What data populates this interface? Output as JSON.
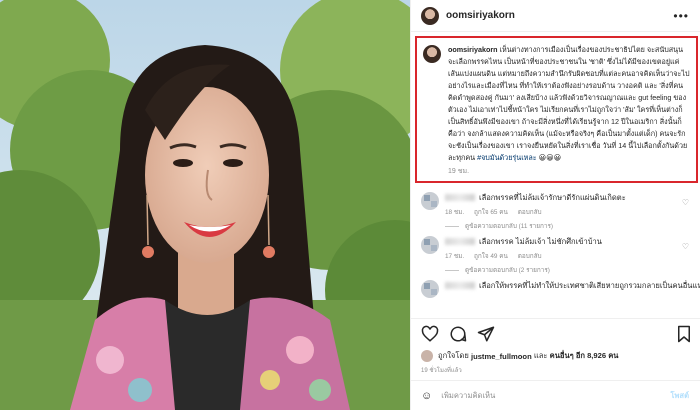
{
  "post": {
    "username": "oomsiriyakorn",
    "more_icon": "more-horizontal-icon"
  },
  "caption": {
    "username": "oomsiriyakorn",
    "text": "เห็นต่างทางการเมืองเป็นเรื่องของประชาธิปไตย จะสนับสนุนจะเลือกพรรคไหน เป็นหน้าที่ของประชาชนใน 'ชาติ' ซึ่งไม่ได้มีของเขตอยู่แค่เส้นแบ่งแผนดิน แต่หมายถึงความสำนึกรับผิดชอบที่แต่ละคนอาจคิดเห็นว่าจะไปอย่างไรและเมืองที่ไหน ที่ทำให้เราต้องฟังอย่างรอบด้าน วางอคติ และ 'สิ่งที่คนคิดดำพูดสองคู่ กันมา' ลงเสียบ้าง แล้วฟังด้วยวิจารณญาณและ gut feeling ของตัวเอง ไม่เอาเท่าไปชี้หน้าใคร ไม่เรียกคนที่เราไม่ถูกใจว่า 'ส้ม' ใครที่เห็นต่างก็เป็นสิทธิ์อันพึงมีของเขา ถ้าจะมีสิ่งหนึ่งที่ได้เรียนรู้จาก 12 ปีในอเมริกา สิ่งนั้นก็คือว่า จงกล้าแสดงความคิดเห็น (แม้จะหรือจริงๆ คือเป็นมาตั้งแต่เด็ก) คนจะรักจะชังเป็นเรื่องของเขา เราจงยืนหยัดในสิ่งที่เราเชื่อ วันที่ 14 นี้ไปเลือกตั้งกันด้วยละทุกคน",
    "hashtag": "#จบมันด้วยรุ่นเหละ",
    "emojis": "😀😀😀",
    "time": "19 ชม."
  },
  "comments": [
    {
      "text": "เลือกพรรคที่ไม่ล้มเจ้ารักษาดีรักแผ่นดินเกิดตะ",
      "time": "18 ชม.",
      "likes": "ถูกใจ 65 คน",
      "reply_label": "ตอบกลับ",
      "replies": "ดูข้อความตอบกลับ (11 รายการ)"
    },
    {
      "text": "เลือกพรรค ไม่ล้มเจ้า ไม่ชักศึกเข้าบ้าน",
      "time": "17 ชม.",
      "likes": "ถูกใจ 49 คน",
      "reply_label": "ตอบกลับ",
      "replies": "ดูข้อความตอบกลับ (2 รายการ)"
    },
    {
      "text": "เลือกให้พรรคที่ไม่ทำให้ประเทศชาติเสียหายถูกรวมกลายเป็นคนอื่นแหละ"
    }
  ],
  "actions": {
    "like_icon": "heart-icon",
    "comment_icon": "comment-icon",
    "share_icon": "share-icon",
    "save_icon": "bookmark-icon"
  },
  "likes": {
    "prefix": "ถูกใจโดย",
    "user": "justme_fullmoon",
    "suffix": "และ",
    "others": "คนอื่นๆ อีก 8,926 คน"
  },
  "date": "19 ชั่วโมงที่แล้ว",
  "add_comment": {
    "emoji_icon": "smiley-icon",
    "placeholder": "เพิ่มความคิดเห็น",
    "post_label": "โพสต์"
  },
  "colors": {
    "highlight_border": "#d9262c",
    "link": "#00376b",
    "muted": "#8e8e8e",
    "post_button": "#b2dffc"
  }
}
